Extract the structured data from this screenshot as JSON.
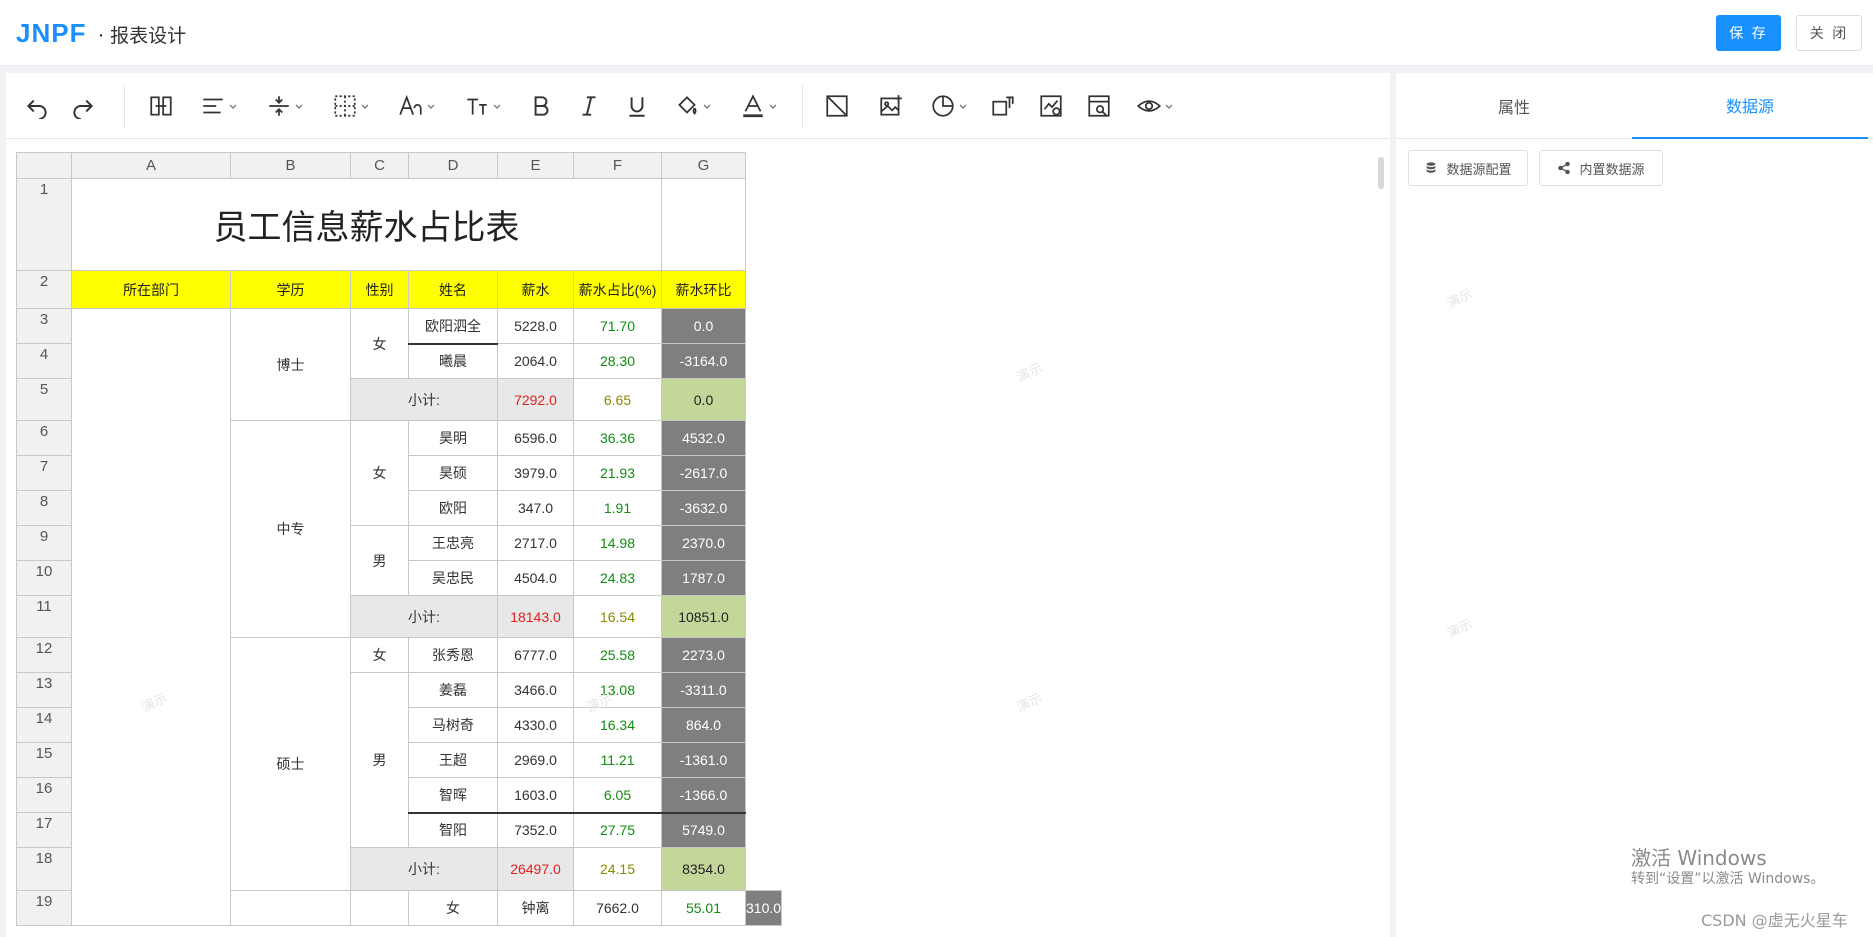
{
  "header": {
    "logo": "JNPF",
    "title": "· 报表设计",
    "save_label": "保 存",
    "close_label": "关 闭"
  },
  "side": {
    "tabs": [
      "属性",
      "数据源"
    ],
    "active_tab": 1,
    "buttons": [
      "数据源配置",
      "内置数据源"
    ]
  },
  "sheet": {
    "columns": [
      "A",
      "B",
      "C",
      "D",
      "E",
      "F",
      "G"
    ],
    "rows": [
      "1",
      "2",
      "3",
      "4",
      "5",
      "6",
      "7",
      "8",
      "9",
      "10",
      "11",
      "12",
      "13",
      "14",
      "15",
      "16",
      "17",
      "18",
      "19"
    ],
    "title": "员工信息薪水占比表",
    "headers": [
      "所在部门",
      "学历",
      "性别",
      "姓名",
      "薪水",
      "薪水占比(%)",
      "薪水环比"
    ],
    "subtotal_label": "小计:",
    "degrees": [
      "博士",
      "中专",
      "硕士"
    ],
    "genders": [
      "女",
      "男"
    ],
    "data_rows": [
      {
        "name": "欧阳泗全",
        "salary": "5228.0",
        "pct": "71.70",
        "mom": "0.0"
      },
      {
        "name": "曦晨",
        "salary": "2064.0",
        "pct": "28.30",
        "mom": "-3164.0"
      },
      {
        "subtotal": true,
        "salary": "7292.0",
        "pct": "6.65",
        "mom": "0.0"
      },
      {
        "name": "昊明",
        "salary": "6596.0",
        "pct": "36.36",
        "mom": "4532.0"
      },
      {
        "name": "昊硕",
        "salary": "3979.0",
        "pct": "21.93",
        "mom": "-2617.0"
      },
      {
        "name": "欧阳",
        "salary": "347.0",
        "pct": "1.91",
        "mom": "-3632.0"
      },
      {
        "name": "王忠亮",
        "salary": "2717.0",
        "pct": "14.98",
        "mom": "2370.0"
      },
      {
        "name": "吴忠民",
        "salary": "4504.0",
        "pct": "24.83",
        "mom": "1787.0"
      },
      {
        "subtotal": true,
        "salary": "18143.0",
        "pct": "16.54",
        "mom": "10851.0"
      },
      {
        "name": "张秀恩",
        "salary": "6777.0",
        "pct": "25.58",
        "mom": "2273.0"
      },
      {
        "name": "姜磊",
        "salary": "3466.0",
        "pct": "13.08",
        "mom": "-3311.0"
      },
      {
        "name": "马树奇",
        "salary": "4330.0",
        "pct": "16.34",
        "mom": "864.0"
      },
      {
        "name": "王超",
        "salary": "2969.0",
        "pct": "11.21",
        "mom": "-1361.0"
      },
      {
        "name": "智晖",
        "salary": "1603.0",
        "pct": "6.05",
        "mom": "-1366.0"
      },
      {
        "name": "智阳",
        "salary": "7352.0",
        "pct": "27.75",
        "mom": "5749.0"
      },
      {
        "subtotal": true,
        "salary": "26497.0",
        "pct": "24.15",
        "mom": "8354.0"
      },
      {
        "name": "钟离",
        "salary": "7662.0",
        "pct": "55.01",
        "mom": "310.0"
      }
    ],
    "watermark": "演示"
  },
  "overlay": {
    "win_line1": "激活 Windows",
    "win_line2": "转到“设置”以激活 Windows。",
    "csdn": "CSDN @虚无火星车"
  }
}
